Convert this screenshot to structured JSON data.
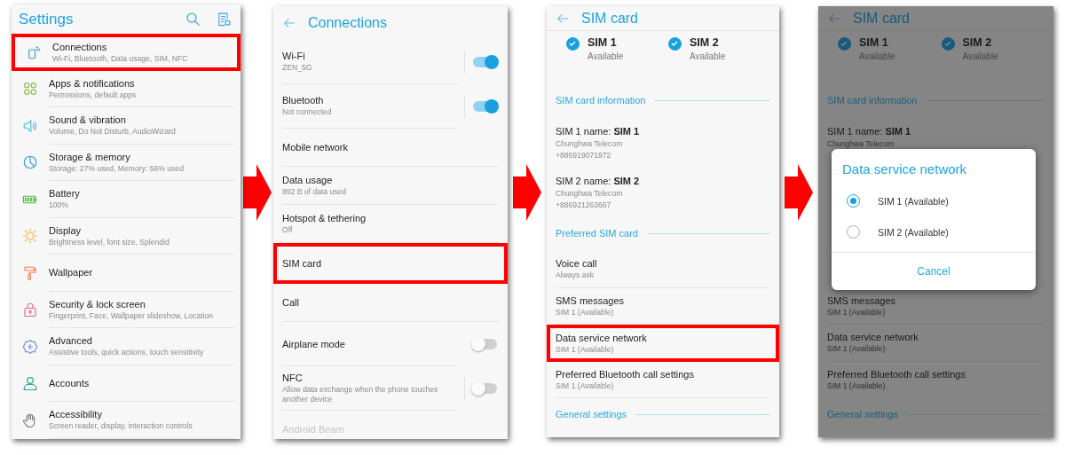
{
  "panels": [
    {
      "kind": "icon_list",
      "header": {
        "title": "Settings",
        "back": false,
        "divider": false
      },
      "dimmed": false,
      "rows": [
        {
          "kind": "item",
          "title": "Connections",
          "subtitle": "Wi-Fi, Bluetooth, Data usage, SIM, NFC",
          "highlighted": true
        },
        {
          "kind": "item",
          "title": "Apps & notifications",
          "subtitle": "Permissions, default apps",
          "highlighted": false
        },
        {
          "kind": "item",
          "title": "Sound & vibration",
          "subtitle": "Volume, Do Not Disturb, AudioWizard",
          "highlighted": false
        },
        {
          "kind": "item",
          "title": "Storage & memory",
          "subtitle": "Storage: 27% used, Memory: 56% used",
          "highlighted": false
        },
        {
          "kind": "item",
          "title": "Battery",
          "subtitle": "100%",
          "highlighted": false
        },
        {
          "kind": "item",
          "title": "Display",
          "subtitle": "Brightness level, font size, Splendid",
          "highlighted": false
        },
        {
          "kind": "item",
          "title": "Wallpaper",
          "highlighted": false
        },
        {
          "kind": "item",
          "title": "Security & lock screen",
          "subtitle": "Fingerprint, Face, Wallpaper slideshow, Location",
          "highlighted": false
        },
        {
          "kind": "item",
          "title": "Advanced",
          "subtitle": "Assistive tools, quick actions, touch sensitivity",
          "highlighted": false
        },
        {
          "kind": "item",
          "title": "Accounts",
          "highlighted": false
        },
        {
          "kind": "item",
          "title": "Accessibility",
          "subtitle": "Screen reader, display, interaction controls",
          "highlighted": false
        }
      ]
    },
    {
      "kind": "plain_list",
      "header": {
        "title": "Connections",
        "back": true,
        "divider": false
      },
      "dimmed": false,
      "rows": [
        {
          "kind": "toggle",
          "title": "Wi-Fi",
          "subtitle": "ZEN_5G",
          "on": true,
          "split": true
        },
        {
          "kind": "toggle",
          "title": "Bluetooth",
          "subtitle": "Not connected",
          "on": true,
          "split": true
        },
        {
          "kind": "item",
          "title": "Mobile network",
          "highlighted": false,
          "disabled": false
        },
        {
          "kind": "item",
          "title": "Data usage",
          "subtitle": "892 B of data used",
          "highlighted": false,
          "disabled": false
        },
        {
          "kind": "item",
          "title": "Hotspot & tethering",
          "subtitle": "Off",
          "highlighted": false,
          "disabled": false
        },
        {
          "kind": "item",
          "title": "SIM card",
          "highlighted": true,
          "disabled": false
        },
        {
          "kind": "item",
          "title": "Call",
          "highlighted": false,
          "disabled": false
        },
        {
          "kind": "toggle",
          "title": "Airplane mode",
          "on": false,
          "split": false
        },
        {
          "kind": "toggle",
          "title": "NFC",
          "subtitle": "Allow data exchange when the phone touches another device",
          "on": false,
          "split": true
        },
        {
          "kind": "item",
          "title": "Android Beam",
          "highlighted": false,
          "disabled": true
        }
      ]
    },
    {
      "kind": "sim_card",
      "header": {
        "title": "SIM card",
        "back": true,
        "divider": true
      },
      "dimmed": false,
      "rows": [
        {
          "kind": "sims",
          "sims": [
            {
              "name": "SIM 1",
              "status": "Available",
              "checked": true
            },
            {
              "name": "SIM 2",
              "status": "Available",
              "checked": true
            }
          ]
        },
        {
          "kind": "section",
          "title": "SIM card information"
        },
        {
          "kind": "info",
          "title": "SIM 1 name: **SIM 1**",
          "lines": [
            "Chunghwa Telecom",
            "+886919071972"
          ]
        },
        {
          "kind": "info",
          "title": "SIM 2 name: **SIM 2**",
          "lines": [
            "Chunghwa Telecom",
            "+886921263667"
          ]
        },
        {
          "kind": "section",
          "title": "Preferred SIM card"
        },
        {
          "kind": "item",
          "title": "Voice call",
          "subtitle": "Always ask",
          "highlighted": false
        },
        {
          "kind": "item",
          "title": "SMS messages",
          "subtitle": "SIM 1 (Available)",
          "highlighted": false
        },
        {
          "kind": "item",
          "title": "Data service network",
          "subtitle": "SIM 1 (Available)",
          "highlighted": true
        },
        {
          "kind": "item",
          "title": "Preferred Bluetooth call settings",
          "subtitle": "SIM 1 (Available)",
          "highlighted": false
        },
        {
          "kind": "section",
          "title": "General settings"
        }
      ]
    },
    {
      "kind": "sim_card",
      "header": {
        "title": "SIM card",
        "back": true,
        "divider": true
      },
      "dimmed": true,
      "rows": [
        {
          "kind": "sims",
          "sims": [
            {
              "name": "SIM 1",
              "status": "Available",
              "checked": true
            },
            {
              "name": "SIM 2",
              "status": "Available",
              "checked": true
            }
          ]
        },
        {
          "kind": "section",
          "title": "SIM card information"
        },
        {
          "kind": "info",
          "title": "SIM 1 name: **SIM 1**",
          "lines": [
            "Chunghwa Telecom"
          ]
        },
        {
          "kind": "covered"
        },
        {
          "kind": "item",
          "title": "SMS messages",
          "subtitle": "SIM 1 (Available)",
          "highlighted": false
        },
        {
          "kind": "item",
          "title": "Data service network",
          "subtitle": "SIM 1 (Available)",
          "highlighted": false
        },
        {
          "kind": "item",
          "title": "Preferred Bluetooth call settings",
          "subtitle": "SIM 1 (Available)",
          "highlighted": false
        },
        {
          "kind": "section",
          "title": "General settings"
        }
      ],
      "dialog": {
        "title": "Data service network",
        "options": [
          {
            "label": "SIM 1 (Available)",
            "selected": true
          },
          {
            "label": "SIM 2 (Available)",
            "selected": false
          }
        ],
        "button": "Cancel"
      }
    }
  ]
}
